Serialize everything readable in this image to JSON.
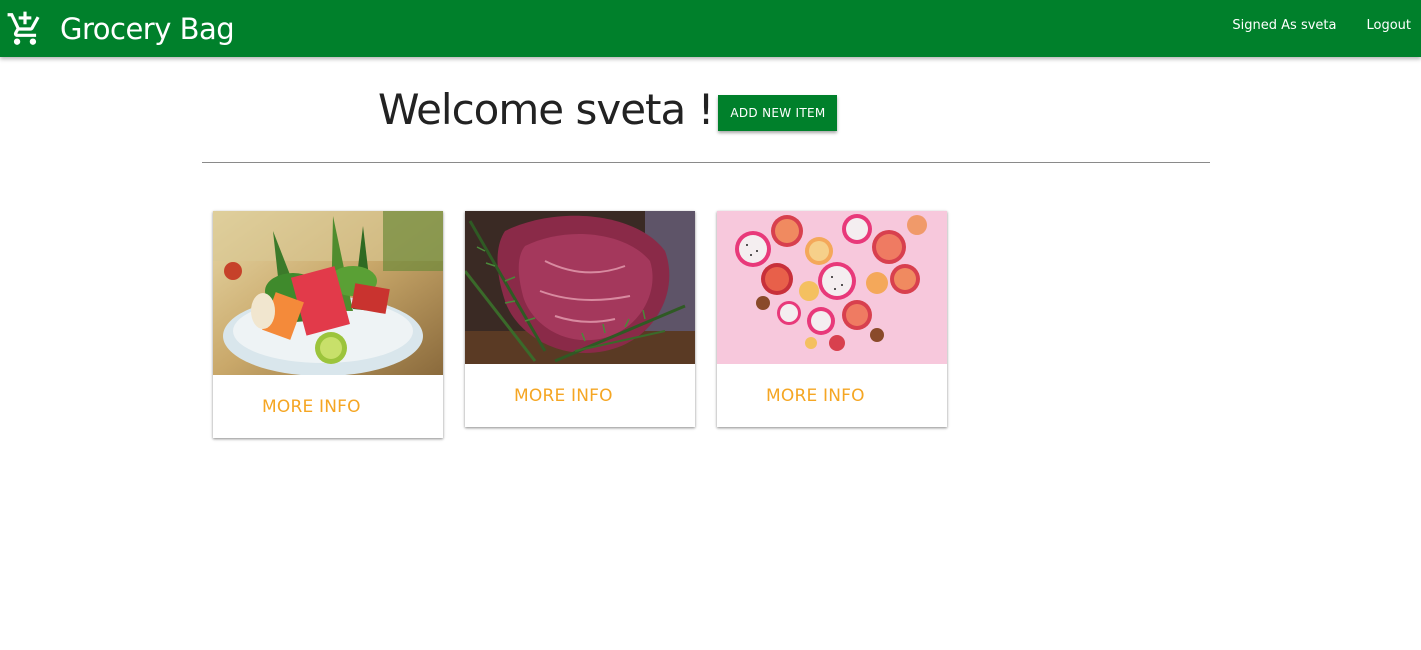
{
  "navbar": {
    "brand": "Grocery Bag",
    "brand_icon": "add-shopping-cart-icon",
    "signed_in": "Signed As sveta",
    "logout": "Logout",
    "bg_color": "#00802b"
  },
  "main": {
    "welcome": "Welcome sveta !",
    "add_button": "ADD NEW ITEM"
  },
  "cards": [
    {
      "image": "sashimi-platter-photo",
      "action": "MORE INFO"
    },
    {
      "image": "raw-meat-rosemary-photo",
      "action": "MORE INFO"
    },
    {
      "image": "dragon-fruit-blood-orange-photo",
      "action": "MORE INFO"
    }
  ],
  "colors": {
    "accent": "#f5a623",
    "primary": "#00802b"
  }
}
